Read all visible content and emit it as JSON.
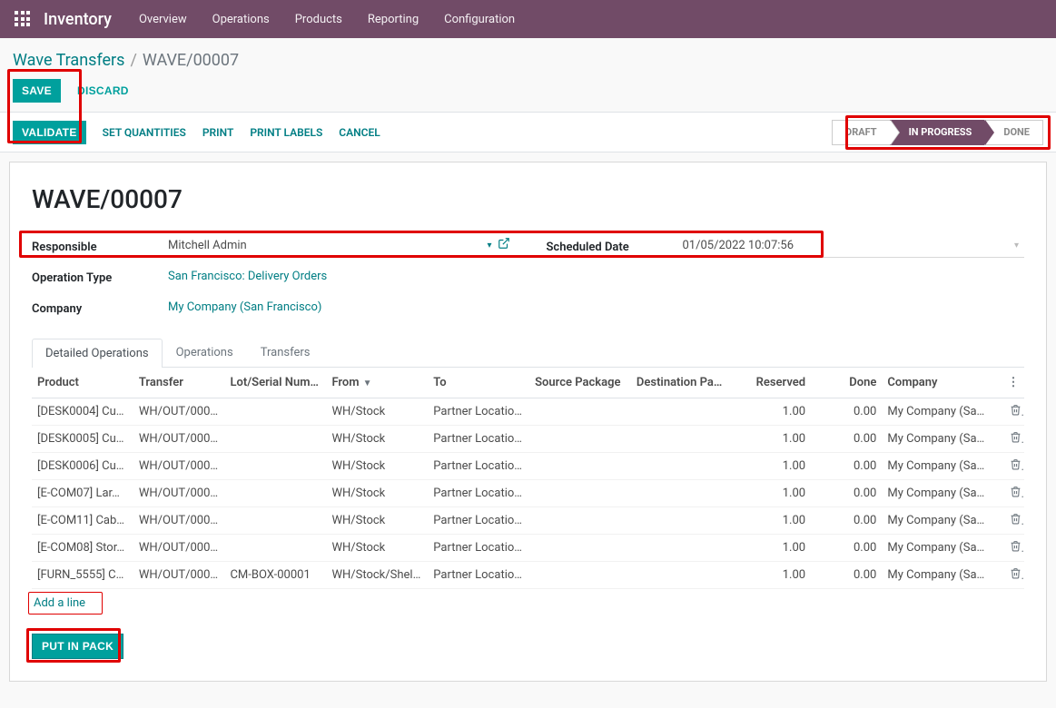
{
  "navbar": {
    "brand": "Inventory",
    "menu": [
      "Overview",
      "Operations",
      "Products",
      "Reporting",
      "Configuration"
    ]
  },
  "breadcrumb": {
    "root": "Wave Transfers",
    "current": "WAVE/00007"
  },
  "action_buttons": {
    "save": "SAVE",
    "discard": "DISCARD"
  },
  "statusbar": {
    "validate": "VALIDATE",
    "set_quantities": "SET QUANTITIES",
    "print": "PRINT",
    "print_labels": "PRINT LABELS",
    "cancel": "CANCEL",
    "steps": [
      "DRAFT",
      "IN PROGRESS",
      "DONE"
    ],
    "active_index": 1
  },
  "record": {
    "title": "WAVE/00007",
    "fields": {
      "responsible_label": "Responsible",
      "responsible_value": "Mitchell Admin",
      "scheduled_date_label": "Scheduled Date",
      "scheduled_date_value": "01/05/2022 10:07:56",
      "operation_type_label": "Operation Type",
      "operation_type_value": "San Francisco: Delivery Orders",
      "company_label": "Company",
      "company_value": "My Company (San Francisco)"
    }
  },
  "tabs": [
    "Detailed Operations",
    "Operations",
    "Transfers"
  ],
  "table": {
    "columns": [
      "Product",
      "Transfer",
      "Lot/Serial Num…",
      "From",
      "To",
      "Source Package",
      "Destination Pa…",
      "Reserved",
      "Done",
      "Company"
    ],
    "rows": [
      {
        "product": "[DESK0004] Cu…",
        "transfer": "WH/OUT/000…",
        "lot": "",
        "from": "WH/Stock",
        "to": "Partner Location…",
        "src": "",
        "dest": "",
        "reserved": "1.00",
        "done": "0.00",
        "company": "My Company (Sa…"
      },
      {
        "product": "[DESK0005] Cu…",
        "transfer": "WH/OUT/000…",
        "lot": "",
        "from": "WH/Stock",
        "to": "Partner Location…",
        "src": "",
        "dest": "",
        "reserved": "1.00",
        "done": "0.00",
        "company": "My Company (Sa…"
      },
      {
        "product": "[DESK0006] Cu…",
        "transfer": "WH/OUT/000…",
        "lot": "",
        "from": "WH/Stock",
        "to": "Partner Location…",
        "src": "",
        "dest": "",
        "reserved": "1.00",
        "done": "0.00",
        "company": "My Company (Sa…"
      },
      {
        "product": "[E-COM07] Lar…",
        "transfer": "WH/OUT/000…",
        "lot": "",
        "from": "WH/Stock",
        "to": "Partner Location…",
        "src": "",
        "dest": "",
        "reserved": "1.00",
        "done": "0.00",
        "company": "My Company (Sa…"
      },
      {
        "product": "[E-COM11] Cab…",
        "transfer": "WH/OUT/000…",
        "lot": "",
        "from": "WH/Stock",
        "to": "Partner Location…",
        "src": "",
        "dest": "",
        "reserved": "1.00",
        "done": "0.00",
        "company": "My Company (Sa…"
      },
      {
        "product": "[E-COM08] Stor…",
        "transfer": "WH/OUT/000…",
        "lot": "",
        "from": "WH/Stock",
        "to": "Partner Location…",
        "src": "",
        "dest": "",
        "reserved": "1.00",
        "done": "0.00",
        "company": "My Company (Sa…"
      },
      {
        "product": "[FURN_5555] C…",
        "transfer": "WH/OUT/000…",
        "lot": "CM-BOX-00001",
        "from": "WH/Stock/Shelf…",
        "to": "Partner Location…",
        "src": "",
        "dest": "",
        "reserved": "1.00",
        "done": "0.00",
        "company": "My Company (Sa…"
      }
    ],
    "add_line": "Add a line",
    "put_in_pack": "PUT IN PACK"
  }
}
